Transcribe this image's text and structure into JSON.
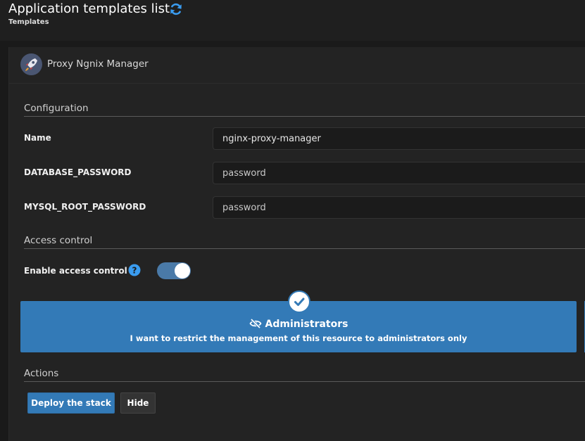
{
  "header": {
    "title": "Application templates list",
    "breadcrumb": "Templates",
    "refresh_icon": "refresh-icon",
    "accent_color": "#3a9cf0"
  },
  "template": {
    "name": "Proxy Ngnix Manager",
    "logo_icon": "rocket-icon"
  },
  "configuration": {
    "section_title": "Configuration",
    "fields": [
      {
        "label": "Name",
        "value": "nginx-proxy-manager"
      },
      {
        "label": "DATABASE_PASSWORD",
        "value": "password"
      },
      {
        "label": "MYSQL_ROOT_PASSWORD",
        "value": "password"
      }
    ]
  },
  "access_control": {
    "section_title": "Access control",
    "toggle_label": "Enable access control",
    "help_icon": "question-circle-icon",
    "enabled": true,
    "option": {
      "title": "Administrators",
      "description": "I want to restrict the management of this resource to administrators only",
      "icon": "eye-slash-icon",
      "selected": true,
      "color": "#337ab7"
    }
  },
  "actions": {
    "section_title": "Actions",
    "deploy_label": "Deploy the stack",
    "hide_label": "Hide"
  }
}
